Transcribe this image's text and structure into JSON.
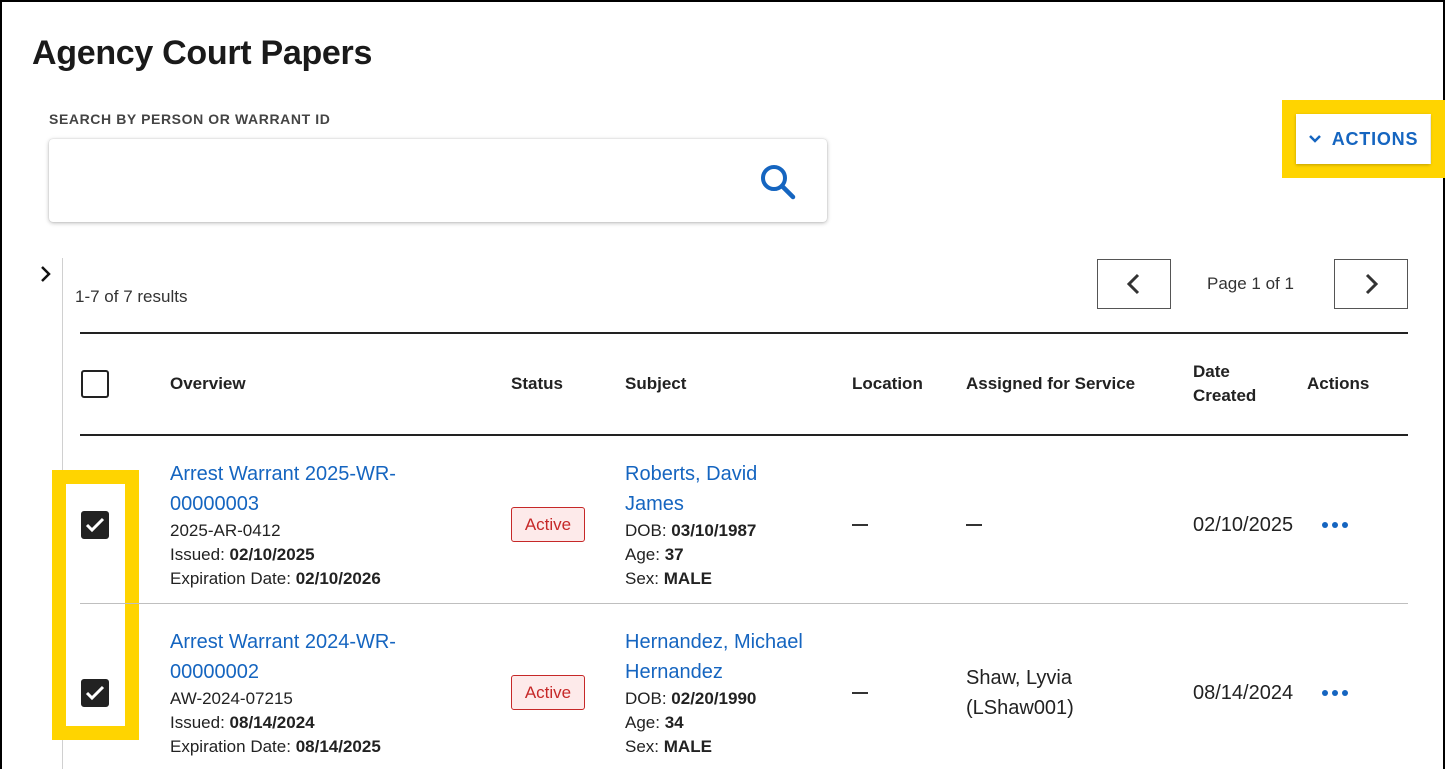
{
  "page": {
    "title": "Agency Court Papers"
  },
  "search": {
    "label": "SEARCH BY PERSON OR WARRANT ID",
    "value": "",
    "placeholder": "",
    "icon": "search-icon"
  },
  "actions": {
    "label": "ACTIONS",
    "icon": "chevron-down-icon"
  },
  "results": {
    "summary": "1-7 of 7 results",
    "page_text": "Page 1 of 1"
  },
  "table": {
    "headers": {
      "overview": "Overview",
      "status": "Status",
      "subject": "Subject",
      "location": "Location",
      "assigned": "Assigned for Service",
      "date_line1": "Date",
      "date_line2": "Created",
      "actions": "Actions"
    },
    "labels": {
      "issued": "Issued:",
      "expiration": "Expiration Date:",
      "dob": "DOB:",
      "age": "Age:",
      "sex": "Sex:"
    },
    "rows": [
      {
        "checked": true,
        "title_line1": "Arrest Warrant 2025-WR-",
        "title_line2": "00000003",
        "ref": "2025-AR-0412",
        "issued": "02/10/2025",
        "expiration": "02/10/2026",
        "status": "Active",
        "subject_line1": "Roberts, David",
        "subject_line2": "James",
        "dob": "03/10/1987",
        "age": "37",
        "sex": "MALE",
        "location": "",
        "assigned_line1": "",
        "assigned_line2": "",
        "date_created": "02/10/2025"
      },
      {
        "checked": true,
        "title_line1": "Arrest Warrant 2024-WR-",
        "title_line2": "00000002",
        "ref": "AW-2024-07215",
        "issued": "08/14/2024",
        "expiration": "08/14/2025",
        "status": "Active",
        "subject_line1": "Hernandez, Michael",
        "subject_line2": "Hernandez",
        "dob": "02/20/1990",
        "age": "34",
        "sex": "MALE",
        "location": "",
        "assigned_line1": "Shaw, Lyvia",
        "assigned_line2": "(LShaw001)",
        "date_created": "08/14/2024"
      }
    ]
  },
  "colors": {
    "accent": "#1565c0",
    "highlight": "#FFD400",
    "status_active": "#c62828"
  }
}
